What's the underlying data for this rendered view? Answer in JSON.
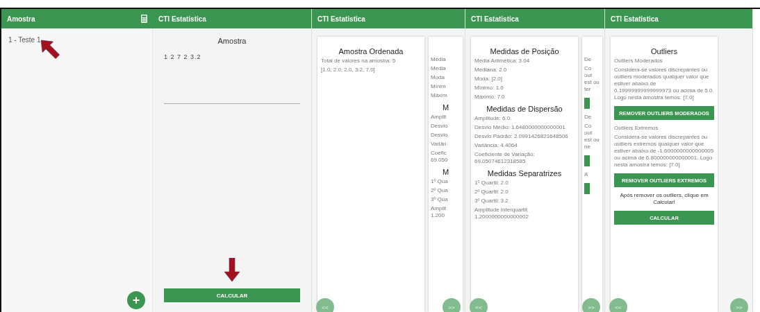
{
  "list_screen": {
    "title": "Amostra",
    "items": [
      {
        "label": "1 - Teste 1",
        "selected": false
      }
    ],
    "add_button": "+"
  },
  "input_screen": {
    "header": "CTI Estatistica",
    "title": "Amostra",
    "value": "1 2 7 2 3.2",
    "button": "CALCULAR"
  },
  "result_screens": [
    {
      "header": "CTI Estatistica",
      "card": [
        {
          "kind": "heading",
          "text": "Amostra Ordenada"
        },
        {
          "kind": "text",
          "text": "Total de valores na amostra: 5"
        },
        {
          "kind": "text",
          "text": "[1.0, 2.0, 2.0, 3.2, 7.0]"
        }
      ],
      "peek": [
        {
          "kind": "text",
          "text": "Média"
        },
        {
          "kind": "text",
          "text": "Media"
        },
        {
          "kind": "text",
          "text": "Moda"
        },
        {
          "kind": "text",
          "text": "Mínim"
        },
        {
          "kind": "text",
          "text": "Máxim"
        },
        {
          "kind": "heading",
          "text": "M"
        },
        {
          "kind": "text",
          "text": "Amplit"
        },
        {
          "kind": "text",
          "text": "Desvio"
        },
        {
          "kind": "text",
          "text": "Desvio"
        },
        {
          "kind": "text",
          "text": "Variân"
        },
        {
          "kind": "text",
          "text": "Coefic 69.050"
        },
        {
          "kind": "heading",
          "text": "M"
        },
        {
          "kind": "text",
          "text": "1º Qua"
        },
        {
          "kind": "text",
          "text": "2º Qua"
        },
        {
          "kind": "text",
          "text": "3º Qua"
        },
        {
          "kind": "text",
          "text": "Amplit 1.200"
        }
      ],
      "nav": [
        "<<",
        ">>"
      ]
    },
    {
      "header": "CTI Estatistica",
      "card": [
        {
          "kind": "heading",
          "text": "Medidas de Posição"
        },
        {
          "kind": "text",
          "text": "Média Aritmética: 3.04"
        },
        {
          "kind": "text",
          "text": "Mediana: 2.0"
        },
        {
          "kind": "text",
          "text": "Moda: [2.0]"
        },
        {
          "kind": "text",
          "text": "Mínimo: 1.0"
        },
        {
          "kind": "text",
          "text": "Máximo: 7.0"
        },
        {
          "kind": "heading",
          "text": "Medidas de Dispersão"
        },
        {
          "kind": "text",
          "text": "Amplitude: 6.0"
        },
        {
          "kind": "text",
          "text": "Desvio Médio: 1.6480000000000001"
        },
        {
          "kind": "text",
          "text": "Desvio Padrão: 2.0991426821648506"
        },
        {
          "kind": "text",
          "text": "Variância: 4.4064"
        },
        {
          "kind": "text",
          "text": "Coeficiente de Variação: 69.05074612318585"
        },
        {
          "kind": "heading",
          "text": "Medidas Separatrizes"
        },
        {
          "kind": "text",
          "text": "1º Quartil: 2.0"
        },
        {
          "kind": "text",
          "text": "2º Quartil: 2.0"
        },
        {
          "kind": "text",
          "text": "3º Quartil: 3.2"
        },
        {
          "kind": "text",
          "text": "Amplitude Interquartil: 1.2000000000000002"
        }
      ],
      "peek": [
        {
          "kind": "text",
          "text": "De"
        },
        {
          "kind": "text",
          "text": "Co out est ou ter"
        },
        {
          "kind": "bar"
        },
        {
          "kind": "text",
          "text": "De"
        },
        {
          "kind": "text",
          "text": "Co out est ou ne"
        },
        {
          "kind": "bar"
        },
        {
          "kind": "text",
          "text": "A"
        },
        {
          "kind": "bar"
        }
      ],
      "nav": [
        "<<",
        ">>"
      ]
    },
    {
      "header": "CTI Estatistica",
      "card": [
        {
          "kind": "heading",
          "text": "Outliers"
        },
        {
          "kind": "text",
          "text": "Outliers Moderados"
        },
        {
          "kind": "text",
          "text": "Considera-se valores discrepantes ou outliers moderados qualquer valor que estiver abaixo de 0.19999999999999973 ou acima de 5.0. Logo nesta amostra temos: [7.0]"
        },
        {
          "kind": "button",
          "text": "REMOVER OUTLIERS MODERADOS"
        },
        {
          "kind": "text",
          "text": "Outliers Extremos"
        },
        {
          "kind": "text",
          "text": "Considera-se valores discrepantes ou outliers extremos qualquer valor que estiver abaixo de -1.6000000000000005 ou acima de 6.800000000000001. Logo nesta amostra temos: [7.0]"
        },
        {
          "kind": "button",
          "text": "REMOVER OUTLIERS EXTREMOS"
        },
        {
          "kind": "note",
          "text": "Após remover os outliers, clique em Calcular!"
        },
        {
          "kind": "button",
          "text": "CALCULAR"
        }
      ],
      "nav": [
        "<<",
        ">>"
      ]
    }
  ]
}
